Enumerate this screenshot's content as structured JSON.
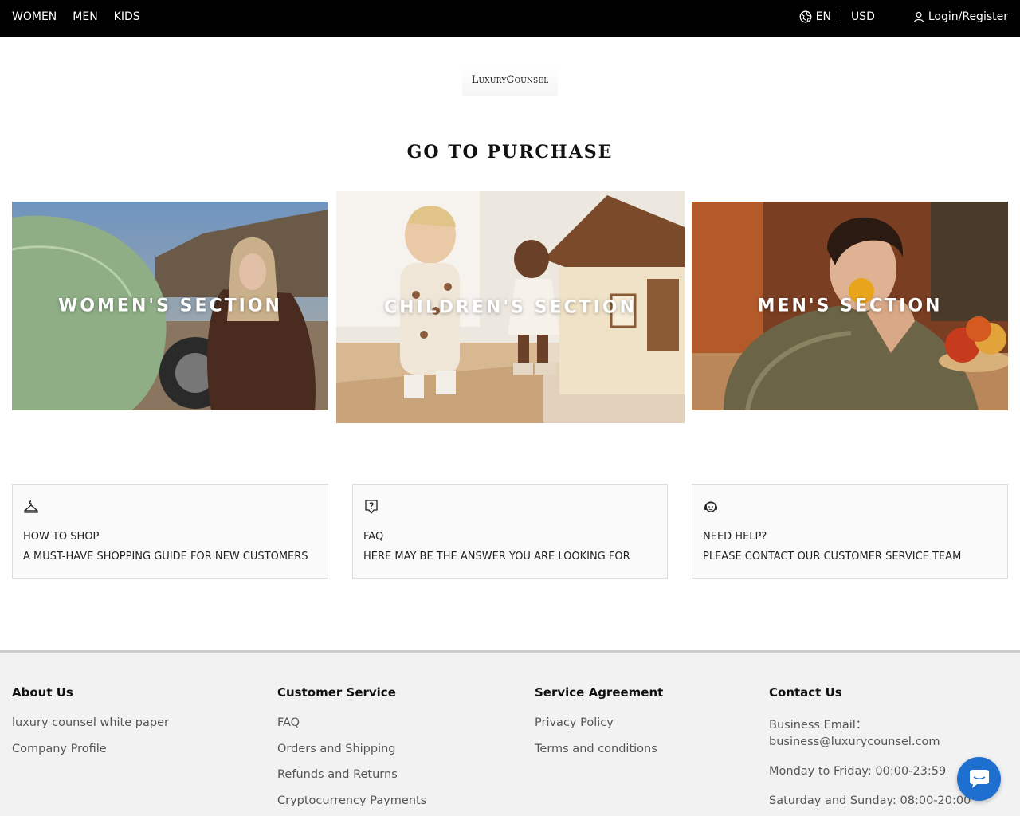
{
  "nav": {
    "items": [
      {
        "label": "WOMEN"
      },
      {
        "label": "MEN"
      },
      {
        "label": "KIDS"
      }
    ],
    "language": "EN",
    "currency": "USD",
    "login": "Login/Register"
  },
  "logo": {
    "text": "LuxuryCounsel"
  },
  "purchase": {
    "title": "GO TO PURCHASE"
  },
  "categories": [
    {
      "label": "WOMEN'S SECTION"
    },
    {
      "label": "CHILDREN'S SECTION"
    },
    {
      "label": "MEN'S SECTION"
    }
  ],
  "info": [
    {
      "icon": "hanger-icon",
      "title": "HOW TO SHOP",
      "subtitle": "A MUST-HAVE SHOPPING GUIDE FOR NEW CUSTOMERS"
    },
    {
      "icon": "question-icon",
      "title": "FAQ",
      "subtitle": "HERE MAY BE THE ANSWER YOU ARE LOOKING FOR"
    },
    {
      "icon": "support-agent-icon",
      "title": "NEED HELP?",
      "subtitle": "PLEASE CONTACT OUR CUSTOMER SERVICE TEAM"
    }
  ],
  "footer": {
    "about": {
      "heading": "About Us",
      "links": [
        "luxury counsel white paper",
        "Company Profile"
      ]
    },
    "service": {
      "heading": "Customer Service",
      "links": [
        "FAQ",
        "Orders and Shipping",
        "Refunds and Returns",
        "Cryptocurrency Payments"
      ]
    },
    "agreement": {
      "heading": "Service Agreement",
      "links": [
        "Privacy Policy",
        "Terms and conditions"
      ]
    },
    "contact": {
      "heading": "Contact Us",
      "email": "Business Email：business@luxurycounsel.com",
      "weekday": "Monday to Friday: 00:00-23:59",
      "weekend": "Saturday and Sunday: 08:00-20:00"
    }
  },
  "colors": {
    "topbar": "#000000",
    "chat": "#1e6fcf",
    "footer_bg": "#f2f2f2"
  }
}
